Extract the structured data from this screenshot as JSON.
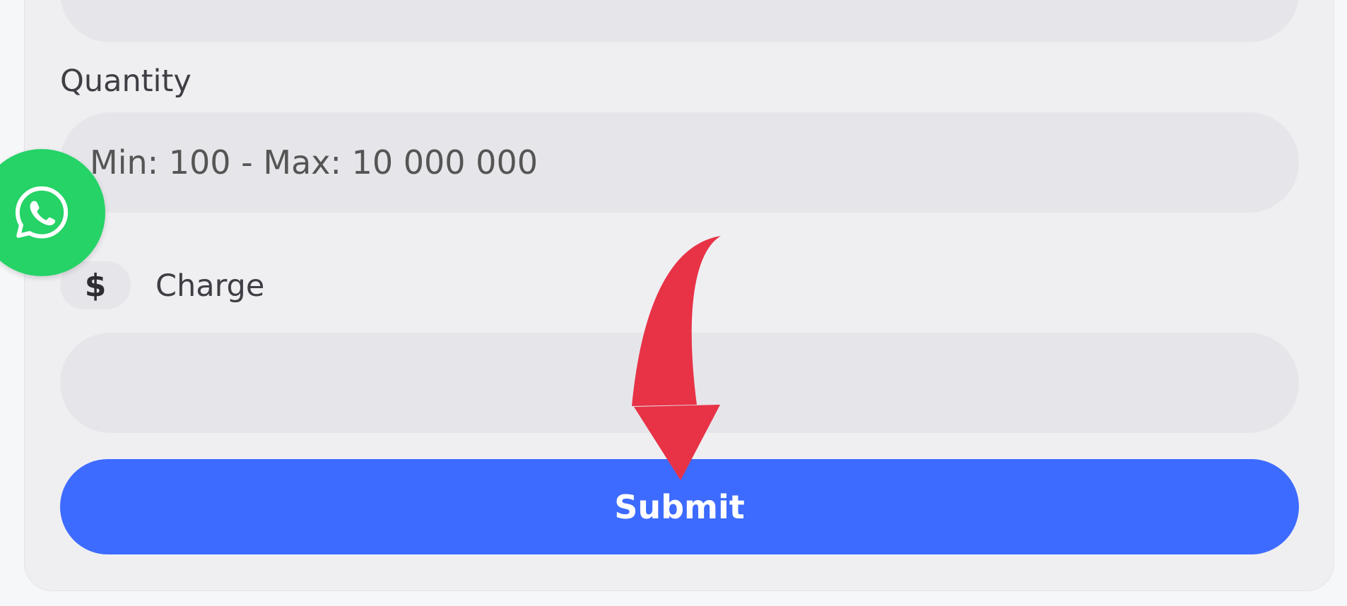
{
  "form": {
    "quantity_label": "Quantity",
    "quantity_placeholder": "Min: 100 - Max: 10 000 000",
    "charge_label": "Charge",
    "charge_icon": "$",
    "charge_value": "",
    "submit_label": "Submit"
  },
  "floating": {
    "icon": "whatsapp-icon"
  },
  "colors": {
    "accent": "#3d6bff",
    "whatsapp": "#25d366",
    "arrow": "#e83246",
    "field_bg": "#e6e6ea",
    "card_bg": "#efeff2"
  }
}
